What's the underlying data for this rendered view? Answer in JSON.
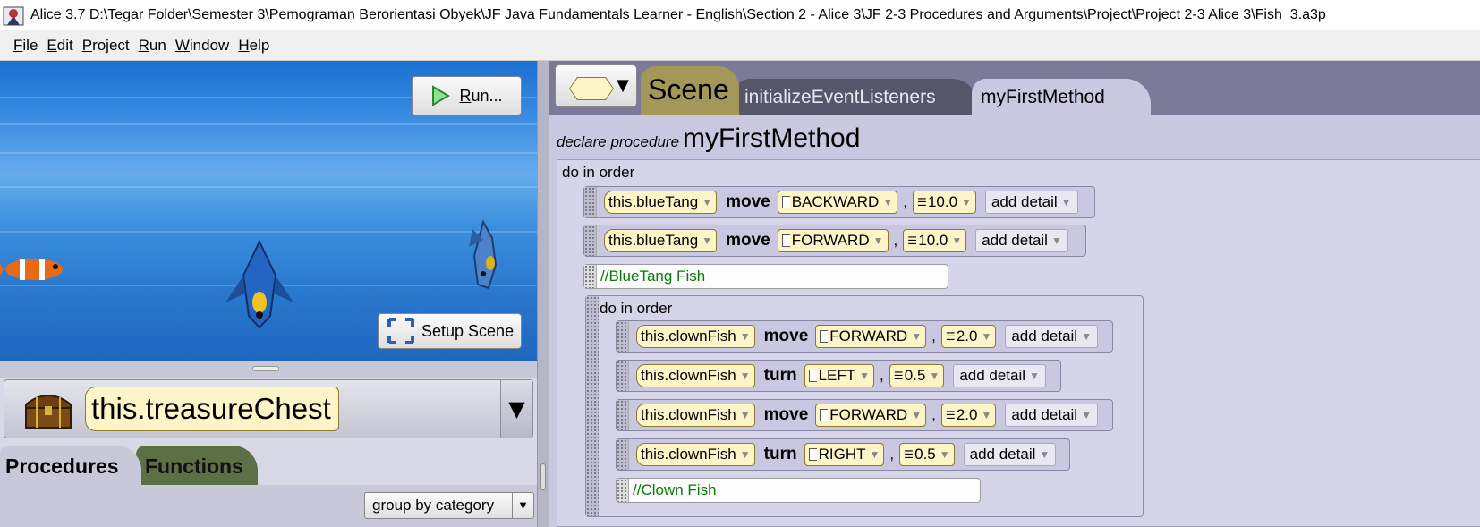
{
  "window": {
    "title": "Alice 3.7 D:\\Tegar Folder\\Semester 3\\Pemograman Berorientasi Obyek\\JF Java Fundamentals Learner - English\\Section 2 - Alice 3\\JF 2-3 Procedures and Arguments\\Project\\Project 2-3 Alice 3\\Fish_3.a3p"
  },
  "menu": [
    {
      "u": "F",
      "rest": "ile"
    },
    {
      "u": "E",
      "rest": "dit"
    },
    {
      "u": "P",
      "rest": "roject"
    },
    {
      "u": "R",
      "rest": "un"
    },
    {
      "u": "W",
      "rest": "indow"
    },
    {
      "u": "H",
      "rest": "elp"
    }
  ],
  "scene": {
    "run_label_u": "R",
    "run_label_rest": "un...",
    "setup_label": "Setup Scene"
  },
  "selected_object": "this.treasureChest",
  "palette_tabs": {
    "procedures": "Procedures",
    "functions": "Functions"
  },
  "group_select": "group by category",
  "editor_tabs": {
    "scene": "Scene",
    "init": "initializeEventListeners",
    "method": "myFirstMethod"
  },
  "declare": {
    "keyword": "declare procedure",
    "name": "myFirstMethod"
  },
  "code": {
    "do_in_order": "do in order",
    "inner_do_in_order": "do in order",
    "add_detail": "add detail",
    "rows": [
      {
        "obj": "this.blueTang",
        "verb": "move",
        "dir": "BACKWARD",
        "amount": "10.0"
      },
      {
        "obj": "this.blueTang",
        "verb": "move",
        "dir": "FORWARD",
        "amount": "10.0"
      }
    ],
    "comment1": "//BlueTang Fish",
    "inner_rows": [
      {
        "obj": "this.clownFish",
        "verb": "move",
        "dir": "FORWARD",
        "amount": "2.0"
      },
      {
        "obj": "this.clownFish",
        "verb": "turn",
        "dir": "LEFT",
        "amount": "0.5"
      },
      {
        "obj": "this.clownFish",
        "verb": "move",
        "dir": "FORWARD",
        "amount": "2.0"
      },
      {
        "obj": "this.clownFish",
        "verb": "turn",
        "dir": "RIGHT",
        "amount": "0.5"
      }
    ],
    "comment2": "//Clown Fish"
  },
  "colors": {
    "editor_bg": "#c9c8e0",
    "tile_yellow": "#fdf5c8",
    "comment_green": "#0a7a0a",
    "functions_tab": "#5b7044",
    "scene_tab": "#a3975a"
  }
}
